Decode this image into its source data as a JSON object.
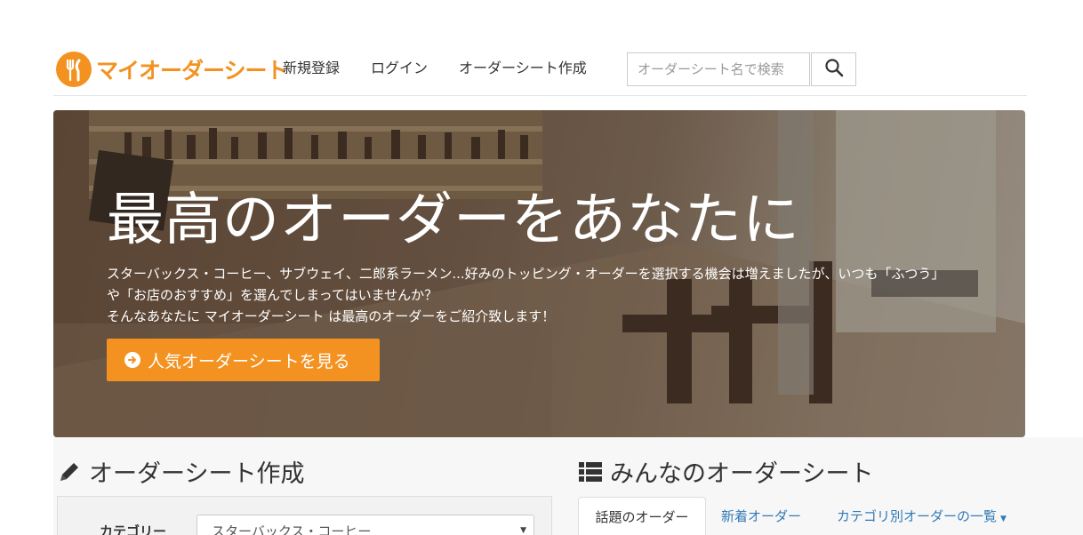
{
  "brand": {
    "name": "マイオーダーシート",
    "color": "#f39221",
    "logo_icon": "fork-knife-icon"
  },
  "nav": {
    "items": [
      {
        "label": "新規登録"
      },
      {
        "label": "ログイン"
      },
      {
        "label": "オーダーシート作成"
      }
    ],
    "search": {
      "placeholder": "オーダーシート名で検索",
      "icon": "search-icon"
    }
  },
  "hero": {
    "title": "最高のオーダーをあなたに",
    "lines": [
      "スターバックス・コーヒー、サブウェイ、二郎系ラーメン...好みのトッピング・オーダーを選択する機会は増えましたが、いつも「ふつう」",
      "や「お店のおすすめ」を選んでしまってはいませんか？",
      "そんなあなたに マイオーダーシート は最高のオーダーをご紹介致します！"
    ],
    "button_label": "人気オーダーシートを見る",
    "button_icon": "arrow-circle-right-icon"
  },
  "create_section": {
    "title": "オーダーシート作成",
    "icon": "pencil-icon",
    "category_label": "カテゴリー",
    "category_value": "スターバックス・コーヒー"
  },
  "list_section": {
    "title": "みんなのオーダーシート",
    "icon": "list-icon",
    "tabs": [
      {
        "label": "話題のオーダー"
      },
      {
        "label": "新着オーダー"
      },
      {
        "label": "カテゴリ別オーダーの一覧"
      }
    ]
  },
  "colors": {
    "accent": "#f39221",
    "link": "#337ab7"
  }
}
